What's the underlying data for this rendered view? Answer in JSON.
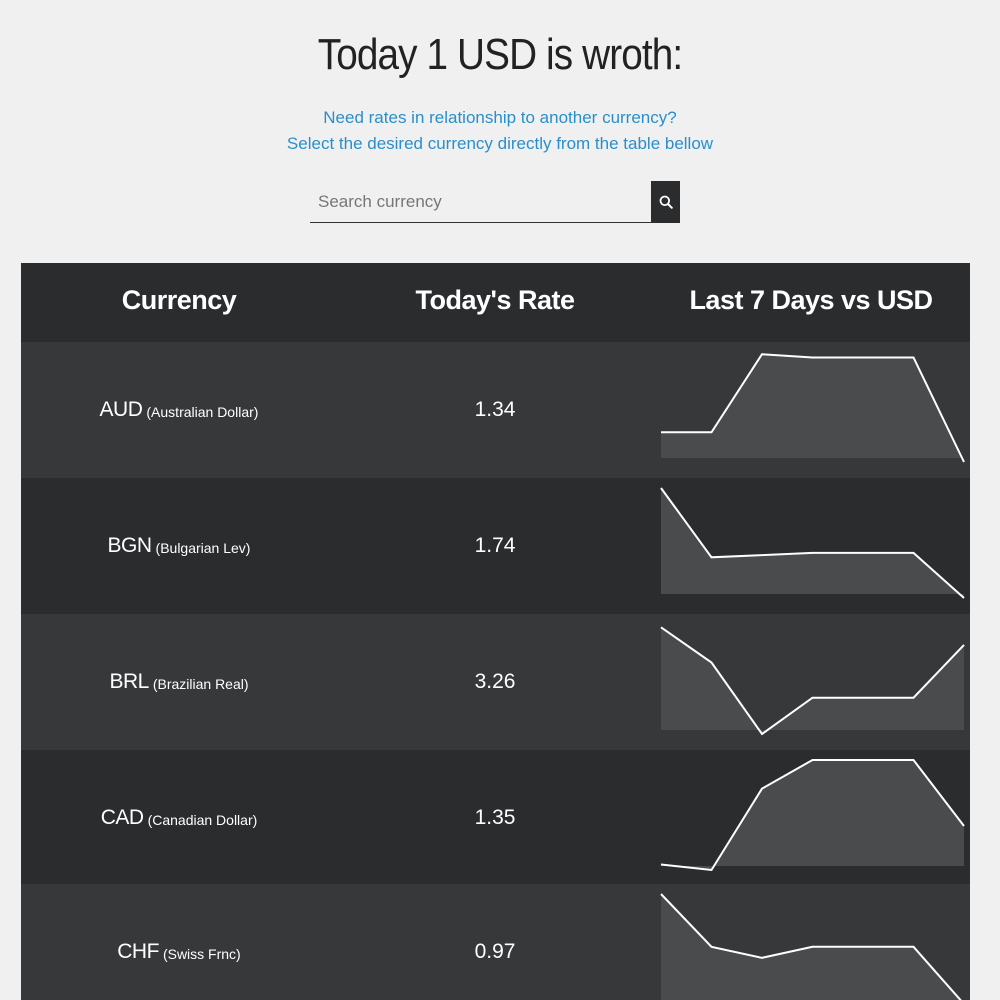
{
  "header": {
    "title": "Today 1 USD is wroth:",
    "subtitle_line1": "Need rates in relationship to another currency?",
    "subtitle_line2": "Select the desired currency directly from the table bellow"
  },
  "search": {
    "placeholder": "Search currency",
    "value": ""
  },
  "table": {
    "columns": [
      "Currency",
      "Today's Rate",
      "Last 7 Days vs USD"
    ],
    "rows": [
      {
        "code": "AUD",
        "name": "(Australian Dollar)",
        "rate": "1.34",
        "trend": [
          0.27,
          0.27,
          0.98,
          0.95,
          0.95,
          0.95,
          0.0
        ]
      },
      {
        "code": "BGN",
        "name": "(Bulgarian Lev)",
        "rate": "1.74",
        "trend": [
          1.0,
          0.37,
          0.39,
          0.41,
          0.41,
          0.41,
          0.0
        ]
      },
      {
        "code": "BRL",
        "name": "(Brazilian Real)",
        "rate": "3.26",
        "trend": [
          0.97,
          0.65,
          0.0,
          0.33,
          0.33,
          0.33,
          0.81
        ]
      },
      {
        "code": "CAD",
        "name": "(Canadian Dollar)",
        "rate": "1.35",
        "trend": [
          0.05,
          0.0,
          0.74,
          1.0,
          1.0,
          1.0,
          0.4
        ]
      },
      {
        "code": "CHF",
        "name": "(Swiss Frnc)",
        "rate": "0.97",
        "trend": [
          1.0,
          0.52,
          0.42,
          0.52,
          0.52,
          0.52,
          0.0
        ]
      }
    ]
  },
  "colors": {
    "accent": "#2a8fc9",
    "table_bg": "#2b2c2e",
    "row_alt": "#37383a",
    "spark_fill": "#4a4b4d",
    "spark_line": "#ffffff"
  },
  "icons": {
    "search_button": "search-icon"
  }
}
